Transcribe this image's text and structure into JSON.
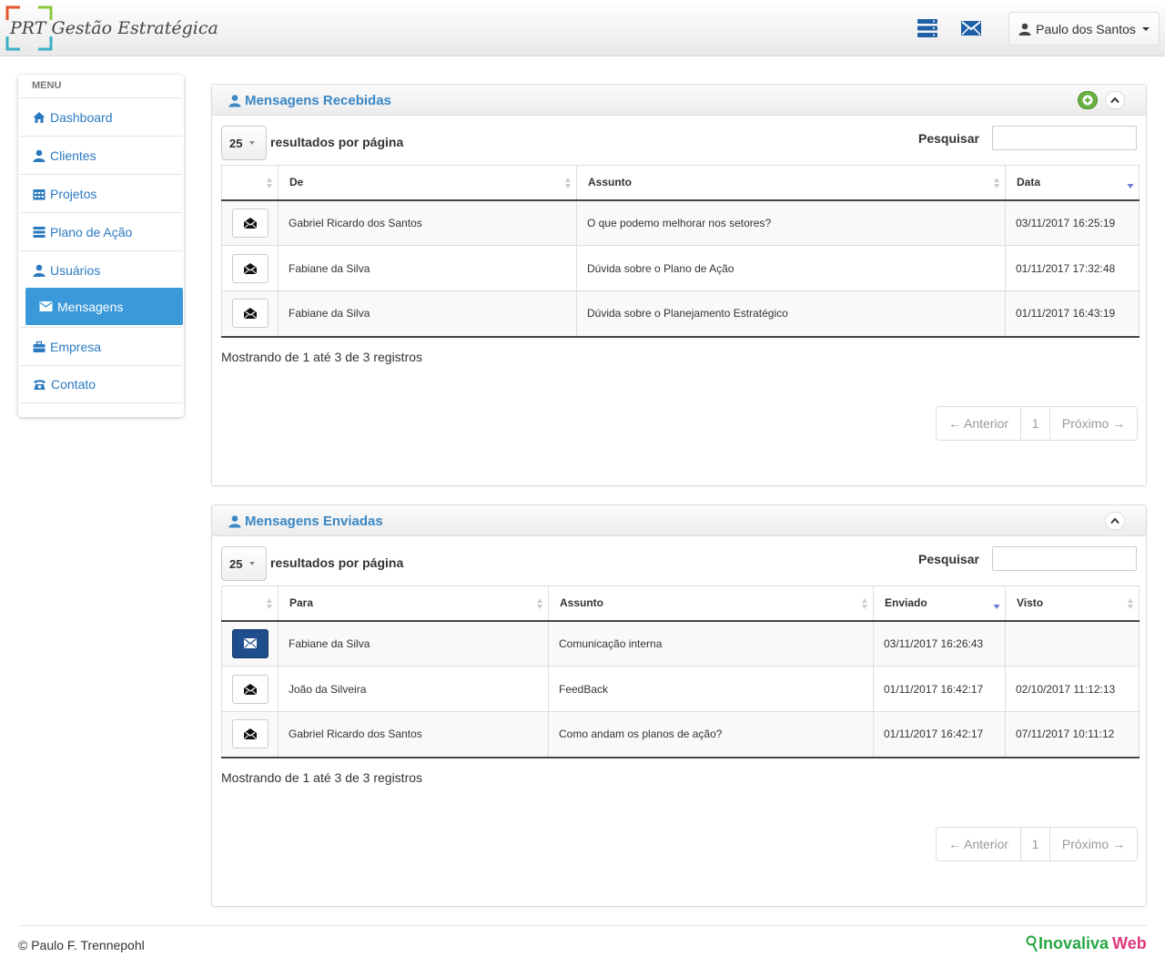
{
  "brand": {
    "logo_mark": "PRT",
    "title": "Gestão Estratégica"
  },
  "header": {
    "user_name": "Paulo dos Santos",
    "icons": [
      "server-icon",
      "envelope-icon"
    ]
  },
  "menu": {
    "title": "MENU",
    "items": [
      {
        "label": "Dashboard",
        "icon": "home-icon"
      },
      {
        "label": "Clientes",
        "icon": "user-icon"
      },
      {
        "label": "Projetos",
        "icon": "calendar-icon"
      },
      {
        "label": "Plano de Ação",
        "icon": "list-icon"
      },
      {
        "label": "Usuários",
        "icon": "user-icon"
      },
      {
        "label": "Mensagens",
        "icon": "envelope-icon",
        "active": true
      },
      {
        "label": "Empresa",
        "icon": "briefcase-icon"
      },
      {
        "label": "Contato",
        "icon": "phone-icon"
      }
    ]
  },
  "received": {
    "title": "Mensagens Recebidas",
    "page_length": "25",
    "length_label": "resultados por página",
    "search_label": "Pesquisar",
    "columns": [
      "",
      "De",
      "Assunto",
      "Data"
    ],
    "rows": [
      {
        "from": "Gabriel Ricardo dos Santos",
        "subject": "O que podemo melhorar nos setores?",
        "date": "03/11/2017 16:25:19"
      },
      {
        "from": "Fabiane da Silva",
        "subject": "Dúvida sobre o Plano de Ação",
        "date": "01/11/2017 17:32:48"
      },
      {
        "from": "Fabiane da Silva",
        "subject": "Dúvida sobre o Planejamento Estratégico",
        "date": "01/11/2017 16:43:19"
      }
    ],
    "info": "Mostrando de 1 até 3 de 3 registros",
    "pager": {
      "prev": "← Anterior",
      "page": "1",
      "next": "Próximo →"
    }
  },
  "sent": {
    "title": "Mensagens Enviadas",
    "page_length": "25",
    "length_label": "resultados por página",
    "search_label": "Pesquisar",
    "columns": [
      "",
      "Para",
      "Assunto",
      "Enviado",
      "Visto"
    ],
    "rows": [
      {
        "to": "Fabiane da Silva",
        "subject": "Comunicação interna",
        "sent": "03/11/2017 16:26:43",
        "seen": "",
        "unread": true
      },
      {
        "to": "João da Silveira",
        "subject": "FeedBack",
        "sent": "01/11/2017 16:42:17",
        "seen": "02/10/2017 11:12:13"
      },
      {
        "to": "Gabriel Ricardo dos Santos",
        "subject": "Como andam os planos de ação?",
        "sent": "01/11/2017 16:42:17",
        "seen": "07/11/2017 10:11:12"
      }
    ],
    "info": "Mostrando de 1 até 3 de 3 registros",
    "pager": {
      "prev": "← Anterior",
      "page": "1",
      "next": "Próximo →"
    }
  },
  "footer": {
    "copyright": "© Paulo F. Trennepohl",
    "brand_part1": "Inovaliva",
    "brand_part2": "Web"
  },
  "colors": {
    "accent": "#3a9ad9",
    "link": "#2a7ac0",
    "brand_green": "#27a844",
    "brand_pink": "#e0387a",
    "unread_button": "#1f4e8c"
  }
}
